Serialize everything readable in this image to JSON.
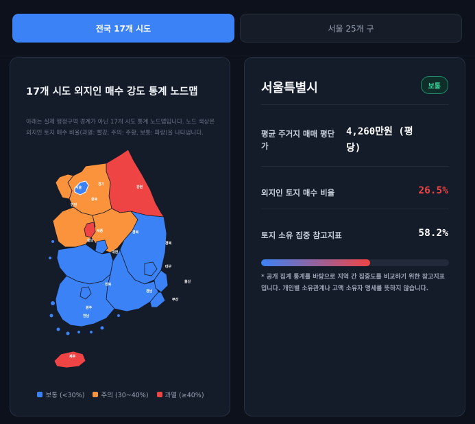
{
  "tabs": [
    {
      "label": "전국 17개 시도",
      "active": true
    },
    {
      "label": "서울 25개 구",
      "active": false
    }
  ],
  "map_panel": {
    "title": "17개 시도 외지인 매수 강도 통계 노드맵",
    "description": "아래는 실제 행정구역 경계가 아닌 17개 시도 통계 노드맵입니다. 노드 색상은 외지인 토지 매수 비율(과열: 빨강, 주의: 주황, 보통: 파랑)을 나타냅니다.",
    "region_labels": {
      "gyeonggi": "경기",
      "gangwon": "강원",
      "seoul": "서울",
      "incheon": "인천",
      "chungbuk": "충북",
      "chungnam": "충남",
      "sejong": "세종",
      "daejeon": "대전",
      "gyeongbuk": "경북",
      "jeonbuk": "전북",
      "daegu": "대구",
      "ulsan": "울산",
      "gyeongnam": "경남",
      "busan": "부산",
      "gwangju": "광주",
      "jeonnam": "전남",
      "jeju": "제주"
    },
    "legend": [
      {
        "label": "보통 (<30%)",
        "color": "#3b82f6"
      },
      {
        "label": "주의 (30~40%)",
        "color": "#fb923c"
      },
      {
        "label": "과열 (≥40%)",
        "color": "#ef4444"
      }
    ]
  },
  "detail_panel": {
    "region_name": "서울특별시",
    "status_badge": "보통",
    "stats": [
      {
        "label_line1": "평균 주거지 매매 평단",
        "label_line2": "가",
        "value_line1": "4,260만원 (평",
        "value_line2": "당)",
        "color": "#ffffff"
      },
      {
        "label_line1": "외지인 토지 매수 비율",
        "value_line1": "26.5%",
        "color": "#ef4444"
      },
      {
        "label_line1": "토지 소유 집중 참고지표",
        "value_line1": "58.2%",
        "color": "#ffffff"
      }
    ],
    "concentration_progress": 0.582,
    "note": "* 공개 집계 통계를 바탕으로 지역 간 집중도를 비교하기 위한 참고지표입니다. 개인별 소유관계나 고액 소유자 명세를 뜻하지 않습니다."
  },
  "colors": {
    "normal": "#3b82f6",
    "caution": "#fb923c",
    "overheat": "#ef4444",
    "accent": "#3b82f6"
  }
}
